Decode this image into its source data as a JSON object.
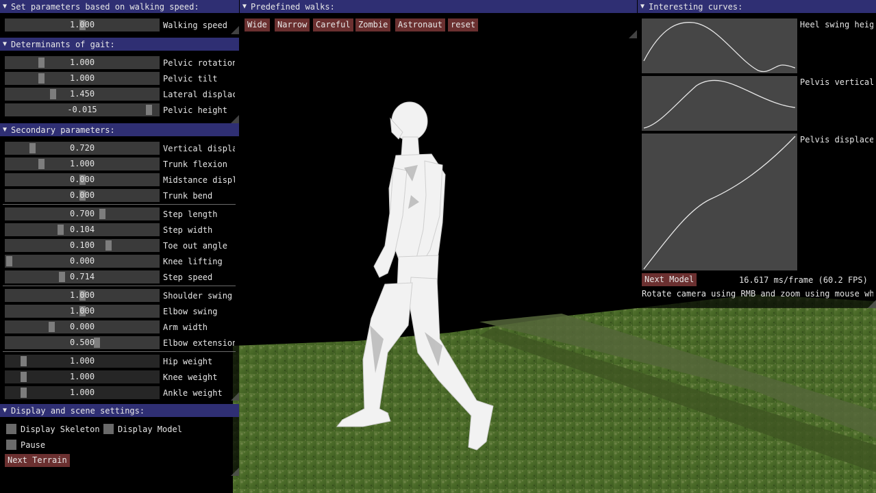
{
  "panels": {
    "walking_speed": {
      "title": "Set parameters based on walking speed:",
      "sliders": [
        {
          "label": "Walking speed",
          "value": "1.000",
          "fraction": 0.5
        }
      ]
    },
    "determinants": {
      "title": "Determinants of gait:",
      "sliders": [
        {
          "label": "Pelvic rotation",
          "value": "1.000",
          "fraction": 0.22
        },
        {
          "label": "Pelvic tilt",
          "value": "1.000",
          "fraction": 0.22
        },
        {
          "label": "Lateral displacement",
          "value": "1.450",
          "fraction": 0.3
        },
        {
          "label": "Pelvic height",
          "value": "-0.015",
          "fraction": 0.96
        }
      ]
    },
    "secondary": {
      "title": "Secondary parameters:",
      "groups": [
        [
          {
            "label": "Vertical displacement",
            "value": "0.720",
            "fraction": 0.16
          },
          {
            "label": "Trunk flexion",
            "value": "1.000",
            "fraction": 0.22
          },
          {
            "label": "Midstance displacement",
            "value": "0.000",
            "fraction": 0.5
          },
          {
            "label": "Trunk bend",
            "value": "0.000",
            "fraction": 0.5
          }
        ],
        [
          {
            "label": "Step length",
            "value": "0.700",
            "fraction": 0.64
          },
          {
            "label": "Step width",
            "value": "0.104",
            "fraction": 0.35
          },
          {
            "label": "Toe out angle",
            "value": "0.100",
            "fraction": 0.68
          },
          {
            "label": "Knee lifting",
            "value": "0.000",
            "fraction": 0.0
          },
          {
            "label": "Step speed",
            "value": "0.714",
            "fraction": 0.36
          }
        ],
        [
          {
            "label": "Shoulder swing",
            "value": "1.000",
            "fraction": 0.5
          },
          {
            "label": "Elbow swing",
            "value": "1.000",
            "fraction": 0.5
          },
          {
            "label": "Arm width",
            "value": "0.000",
            "fraction": 0.29
          },
          {
            "label": "Elbow extension",
            "value": "0.500",
            "fraction": 0.6
          }
        ],
        [
          {
            "label": "Hip weight",
            "value": "1.000",
            "fraction": 0.1
          },
          {
            "label": "Knee weight",
            "value": "1.000",
            "fraction": 0.1
          },
          {
            "label": "Ankle weight",
            "value": "1.000",
            "fraction": 0.1
          }
        ]
      ]
    },
    "display": {
      "title": "Display and scene settings:",
      "display_skeleton": "Display Skeleton",
      "display_model": "Display Model",
      "pause": "Pause",
      "next_terrain": "Next Terrain"
    },
    "predefined": {
      "title": "Predefined walks:",
      "buttons": [
        "Wide",
        "Narrow",
        "Careful",
        "Zombie",
        "Astronaut",
        "reset"
      ]
    },
    "curves": {
      "title": "Interesting curves:",
      "labels": [
        "Heel swing height",
        "Pelvis vertical",
        "Pelvis displacement"
      ],
      "next_model": "Next Model",
      "fps": "16.617 ms/frame (60.2 FPS)",
      "help": "Rotate camera using RMB and zoom using mouse wheel"
    }
  },
  "colors": {
    "title_bar": "#2f2f73",
    "button": "#6b3030",
    "slider_bg": "#3a3a3a",
    "slider_grab": "#7d7d7d",
    "curve_bg": "#464646",
    "grass": "#4b6a2a"
  }
}
